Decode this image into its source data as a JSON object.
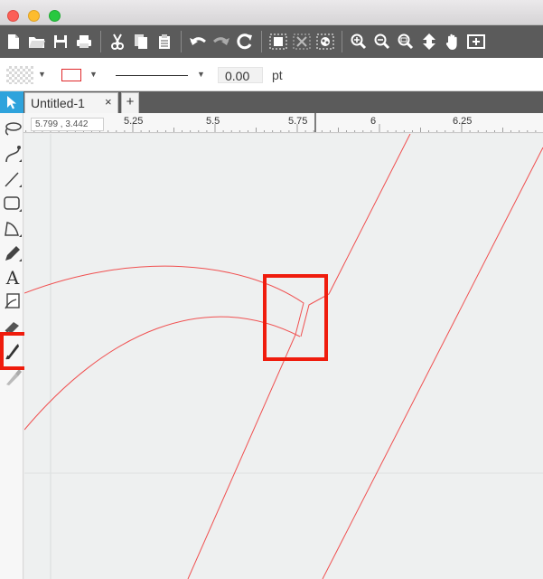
{
  "window": {
    "traffic_lights": [
      "close",
      "minimize",
      "maximize"
    ]
  },
  "toolbar": {
    "buttons": [
      {
        "name": "new-document-icon"
      },
      {
        "name": "open-folder-icon"
      },
      {
        "name": "save-icon"
      },
      {
        "name": "print-icon"
      },
      {
        "name": "cut-icon"
      },
      {
        "name": "copy-icon"
      },
      {
        "name": "paste-icon"
      },
      {
        "name": "undo-icon"
      },
      {
        "name": "redo-icon"
      },
      {
        "name": "refresh-icon"
      },
      {
        "name": "group-icon"
      },
      {
        "name": "ungroup-icon"
      },
      {
        "name": "effects-icon"
      },
      {
        "name": "zoom-in-icon"
      },
      {
        "name": "zoom-out-icon"
      },
      {
        "name": "zoom-selection-icon"
      },
      {
        "name": "move-page-icon"
      },
      {
        "name": "pan-hand-icon"
      },
      {
        "name": "fit-page-icon"
      }
    ]
  },
  "properties": {
    "line_width": "0.00",
    "line_unit": "pt",
    "fill_icon": "transparent-fill-swatch",
    "stroke_color": "#e0282a"
  },
  "tabs": [
    {
      "label": "Untitled-1",
      "close": "×"
    }
  ],
  "tab_add": "+",
  "ruler": {
    "coordinates": "5.799 , 3.442",
    "ticks": [
      "5.25",
      "5.5",
      "5.75",
      "6",
      "6.25"
    ]
  },
  "tools": [
    {
      "name": "lasso-tool-icon"
    },
    {
      "name": "bezier-tool-icon"
    },
    {
      "name": "line-tool-icon"
    },
    {
      "name": "rectangle-tool-icon"
    },
    {
      "name": "polygon-tool-icon"
    },
    {
      "name": "pencil-tool-icon"
    },
    {
      "name": "text-tool-icon",
      "glyph": "A"
    },
    {
      "name": "image-trace-tool-icon"
    },
    {
      "name": "eraser-tool-icon"
    },
    {
      "name": "knife-tool-icon"
    },
    {
      "name": "eyedropper-tool-icon"
    }
  ],
  "colors": {
    "toolbar_bg": "#5b5b5b",
    "accent_blue": "#2ea3dc",
    "canvas_bg": "#eef0f0",
    "cut_line": "#f05050",
    "highlight": "#ef1c0d"
  }
}
